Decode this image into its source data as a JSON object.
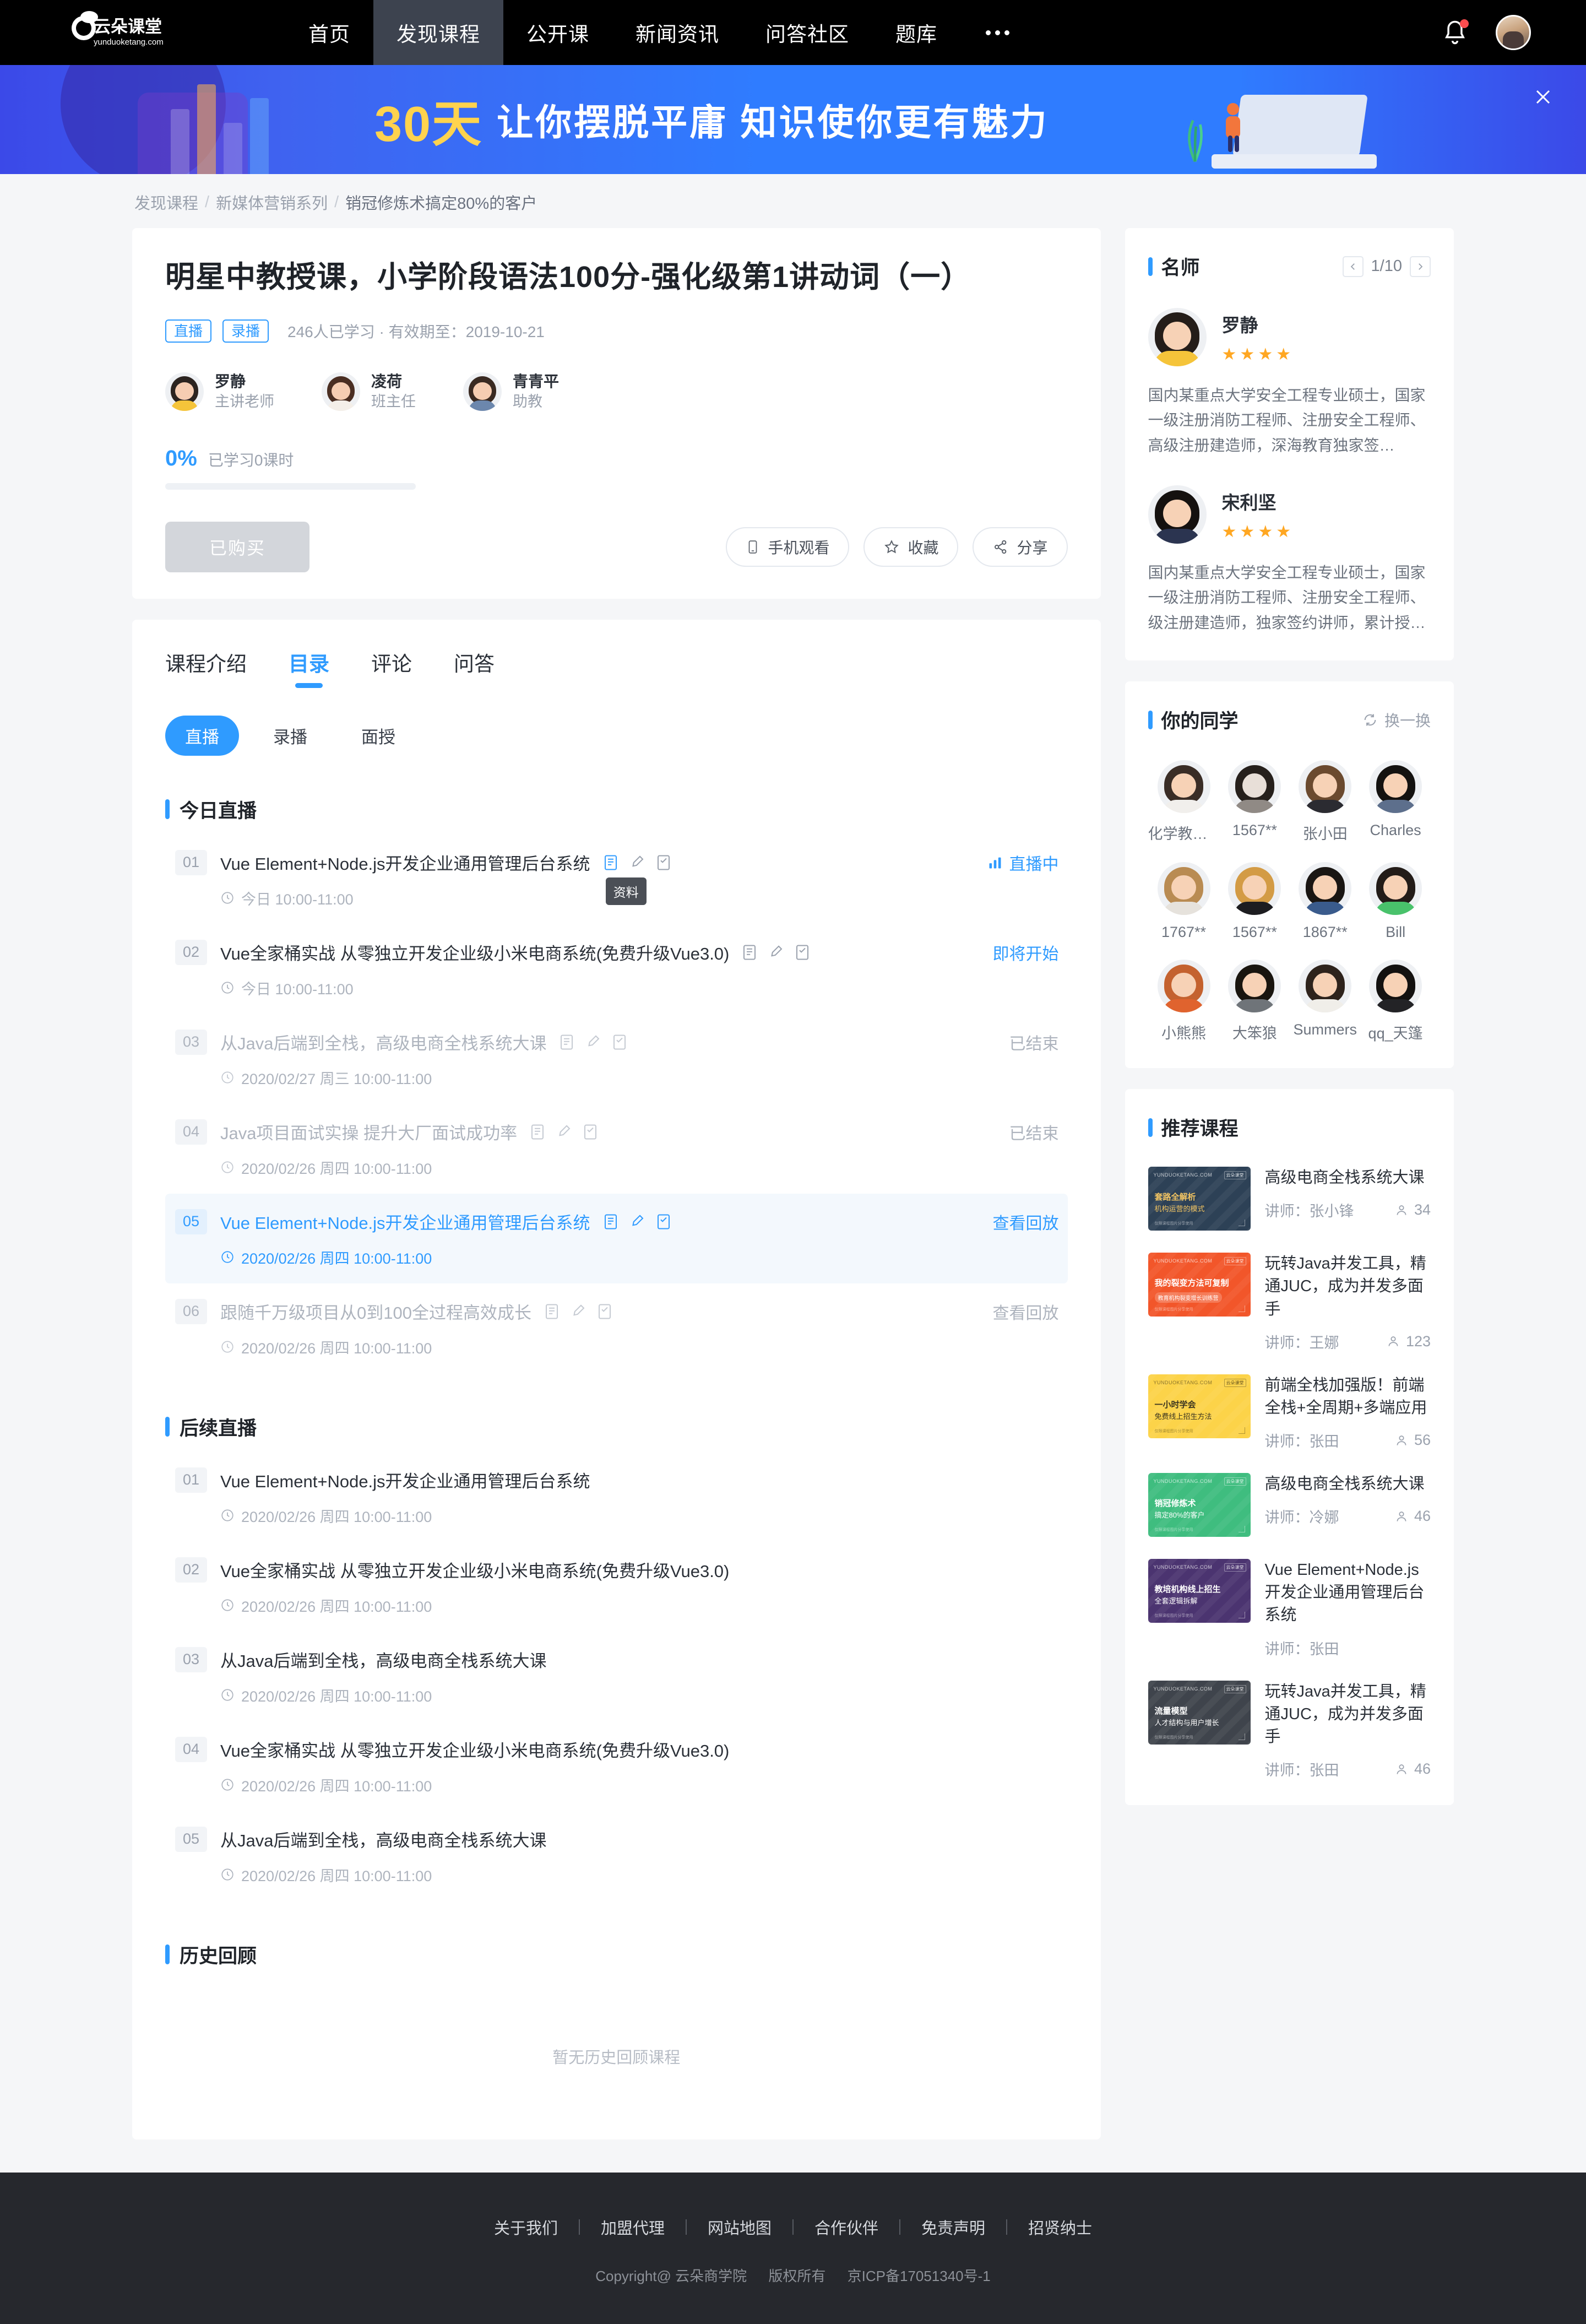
{
  "nav": {
    "logo_text": "云朵课堂",
    "logo_sub": "yunduoketang.com",
    "items": [
      {
        "label": "首页",
        "active": false
      },
      {
        "label": "发现课程",
        "active": true
      },
      {
        "label": "公开课",
        "active": false
      },
      {
        "label": "新闻资讯",
        "active": false
      },
      {
        "label": "问答社区",
        "active": false
      },
      {
        "label": "题库",
        "active": false
      }
    ],
    "more_icon": "more-dots-icon",
    "bell_icon": "bell-icon",
    "avatar_icon": "user-avatar"
  },
  "banner": {
    "highlight": "30天",
    "headline": "让你摆脱平庸 知识使你更有魅力",
    "close_icon": "close-icon"
  },
  "breadcrumb": {
    "items": [
      "发现课程",
      "新媒体营销系列",
      "销冠修炼术搞定80%的客户"
    ],
    "separator": "/"
  },
  "course": {
    "title": "明星中教授课，小学阶段语法100分-强化级第1讲动词（一）",
    "tags": [
      "直播",
      "录播"
    ],
    "meta": "246人已学习 · 有效期至：2019-10-21",
    "teachers": [
      {
        "name": "罗静",
        "role": "主讲老师"
      },
      {
        "name": "凌荷",
        "role": "班主任"
      },
      {
        "name": "青青平",
        "role": "助教"
      }
    ],
    "progress_pct": "0%",
    "progress_label": "已学习0课时",
    "progress_value": 0,
    "buy_button": "已购买",
    "actions": [
      {
        "label": "手机观看",
        "icon": "mobile-icon"
      },
      {
        "label": "收藏",
        "icon": "star-icon"
      },
      {
        "label": "分享",
        "icon": "share-icon"
      }
    ]
  },
  "catalog": {
    "tabs": [
      {
        "label": "课程介绍",
        "active": false
      },
      {
        "label": "目录",
        "active": true
      },
      {
        "label": "评论",
        "active": false
      },
      {
        "label": "问答",
        "active": false
      }
    ],
    "subtabs": [
      {
        "label": "直播",
        "active": true
      },
      {
        "label": "录播",
        "active": false
      },
      {
        "label": "面授",
        "active": false
      }
    ],
    "tooltip": "资料",
    "sections": [
      {
        "title": "今日直播",
        "lessons": [
          {
            "num": "01",
            "title": "Vue Element+Node.js开发企业通用管理后台系统",
            "time": "今日 10:00-11:00",
            "status": "直播中",
            "state": "live",
            "icons": true,
            "tooltip": true
          },
          {
            "num": "02",
            "title": "Vue全家桶实战 从零独立开发企业级小米电商系统(免费升级Vue3.0)",
            "time": "今日 10:00-11:00",
            "status": "即将开始",
            "state": "soon",
            "icons": true
          },
          {
            "num": "03",
            "title": "从Java后端到全栈，高级电商全栈系统大课",
            "time": "2020/02/27 周三 10:00-11:00",
            "status": "已结束",
            "state": "ended",
            "icons": true
          },
          {
            "num": "04",
            "title": "Java项目面试实操 提升大厂面试成功率",
            "time": "2020/02/26 周四 10:00-11:00",
            "status": "已结束",
            "state": "ended",
            "icons": true
          },
          {
            "num": "05",
            "title": "Vue Element+Node.js开发企业通用管理后台系统",
            "time": "2020/02/26 周四 10:00-11:00",
            "status": "查看回放",
            "state": "highlight",
            "icons": true
          },
          {
            "num": "06",
            "title": "跟随千万级项目从0到100全过程高效成长",
            "time": "2020/02/26 周四 10:00-11:00",
            "status": "查看回放",
            "state": "replay-muted",
            "icons": true
          }
        ]
      },
      {
        "title": "后续直播",
        "lessons": [
          {
            "num": "01",
            "title": "Vue Element+Node.js开发企业通用管理后台系统",
            "time": "2020/02/26 周四 10:00-11:00",
            "status": "",
            "state": "plain",
            "icons": false
          },
          {
            "num": "02",
            "title": "Vue全家桶实战 从零独立开发企业级小米电商系统(免费升级Vue3.0)",
            "time": "2020/02/26 周四 10:00-11:00",
            "status": "",
            "state": "plain",
            "icons": false
          },
          {
            "num": "03",
            "title": "从Java后端到全栈，高级电商全栈系统大课",
            "time": "2020/02/26 周四 10:00-11:00",
            "status": "",
            "state": "plain",
            "icons": false
          },
          {
            "num": "04",
            "title": "Vue全家桶实战 从零独立开发企业级小米电商系统(免费升级Vue3.0)",
            "time": "2020/02/26 周四 10:00-11:00",
            "status": "",
            "state": "plain",
            "icons": false
          },
          {
            "num": "05",
            "title": "从Java后端到全栈，高级电商全栈系统大课",
            "time": "2020/02/26 周四 10:00-11:00",
            "status": "",
            "state": "plain",
            "icons": false
          }
        ]
      },
      {
        "title": "历史回顾",
        "empty_text": "暂无历史回顾课程",
        "lessons": []
      }
    ]
  },
  "sidebar": {
    "teachers_panel": {
      "title": "名师",
      "page": "1/10",
      "prev_icon": "chevron-left-icon",
      "next_icon": "chevron-right-icon",
      "teachers": [
        {
          "name": "罗静",
          "stars": 4,
          "desc": "国内某重点大学安全工程专业硕士，国家一级注册消防工程师、注册安全工程师、高级注册建造师，深海教育独家签…"
        },
        {
          "name": "宋利坚",
          "stars": 4,
          "desc": "国内某重点大学安全工程专业硕士，国家一级注册消防工程师、注册安全工程师、级注册建造师，独家签约讲师，累计授…"
        }
      ]
    },
    "mates_panel": {
      "title": "你的同学",
      "refresh_label": "换一换",
      "refresh_icon": "refresh-icon",
      "mates": [
        {
          "name": "化学教书…"
        },
        {
          "name": "1567**"
        },
        {
          "name": "张小田"
        },
        {
          "name": "Charles"
        },
        {
          "name": "1767**"
        },
        {
          "name": "1567**"
        },
        {
          "name": "1867**"
        },
        {
          "name": "Bill"
        },
        {
          "name": "小熊熊"
        },
        {
          "name": "大笨狼"
        },
        {
          "name": "Summers"
        },
        {
          "name": "qq_天篷"
        }
      ]
    },
    "recommend_panel": {
      "title": "推荐课程",
      "teacher_prefix": "讲师：",
      "courses": [
        {
          "title": "高级电商全栈系统大课",
          "teacher": "张小锋",
          "count": "34",
          "thumb_color": "#2d4156",
          "thumb_accent": "#f2c462",
          "thumb_line1": "套路全解析",
          "thumb_line2": "机构运营的模式",
          "thumb_logo": "YUNDUOKETANG.COM",
          "thumb_badge": "云朵课堂",
          "thumb_foot": "仅限课程图片分享使用"
        },
        {
          "title": "玩转Java并发工具，精通JUC，成为并发多面手",
          "teacher": "王娜",
          "count": "123",
          "thumb_color": "#f2562a",
          "thumb_accent": "#ffffff",
          "thumb_line1": "我的裂变方法可复制",
          "thumb_line2": "教育机构裂变增长训练营",
          "thumb_logo": "YUNDUOKETANG.COM",
          "thumb_badge": "云朵课堂",
          "thumb_foot": "仅限课程图片分享使用"
        },
        {
          "title": "前端全栈加强版！前端全栈+全周期+多端应用",
          "teacher": "张田",
          "count": "56",
          "thumb_color": "#fcd349",
          "thumb_accent": "#3a3420",
          "thumb_line1": "一小时学会",
          "thumb_line2": "免费线上招生方法",
          "thumb_logo": "YUNDUOKETANG.COM",
          "thumb_badge": "云朵课堂",
          "thumb_foot": "仅限课程图片分享使用"
        },
        {
          "title": "高级电商全栈系统大课",
          "teacher": "冷娜",
          "count": "46",
          "thumb_color": "#3fbd7f",
          "thumb_accent": "#ffffff",
          "thumb_line1": "销冠修炼术",
          "thumb_line2": "搞定80%的客户",
          "thumb_logo": "YUNDUOKETANG.COM",
          "thumb_badge": "云朵课堂",
          "thumb_foot": "仅限课程图片分享使用"
        },
        {
          "title": "Vue Element+Node.js开发企业通用管理后台系统",
          "teacher": "张田",
          "count": "",
          "thumb_color": "#4b3470",
          "thumb_accent": "#ffffff",
          "thumb_line1": "教培机构线上招生",
          "thumb_line2": "全套逻辑拆解",
          "thumb_logo": "YUNDUOKETANG.COM",
          "thumb_badge": "云朵课堂",
          "thumb_foot": "仅限课程图片分享使用"
        },
        {
          "title": "玩转Java并发工具，精通JUC，成为并发多面手",
          "teacher": "张田",
          "count": "46",
          "thumb_color": "#3f444c",
          "thumb_accent": "#ffffff",
          "thumb_line1": "流量模型",
          "thumb_line2": "人才结构与用户增长",
          "thumb_logo": "YUNDUOKETANG.COM",
          "thumb_badge": "云朵课堂",
          "thumb_foot": "仅限课程图片分享使用"
        }
      ]
    }
  },
  "footer": {
    "links": [
      "关于我们",
      "加盟代理",
      "网站地图",
      "合作伙伴",
      "免责声明",
      "招贤纳士"
    ],
    "copyright": "Copyright@ 云朵商学院",
    "rights": "版权所有",
    "icp": "京ICP备17051340号-1"
  },
  "colors": {
    "accent": "#2f9bff",
    "nav_bg": "#000000",
    "nav_active_bg": "#3d434f",
    "page_bg": "#f5f6f8",
    "footer_bg": "#26282d",
    "star": "#ffa722"
  }
}
